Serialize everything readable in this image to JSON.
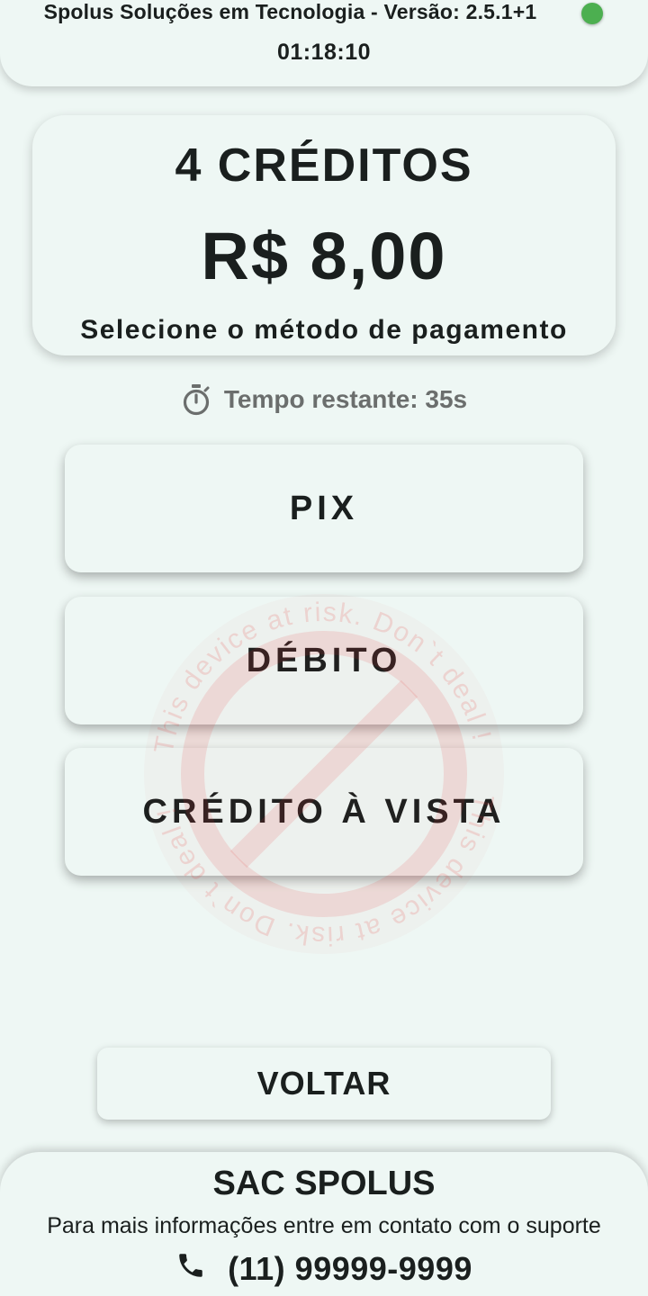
{
  "header": {
    "title": "Spolus Soluções em Tecnologia - Versão: 2.5.1+1",
    "clock": "01:18:10",
    "status_color": "#4caf50"
  },
  "summary": {
    "credits": "4 CRÉDITOS",
    "price": "R$ 8,00",
    "instruction": "Selecione o método de pagamento"
  },
  "timer": {
    "icon": "stopwatch-icon",
    "text": "Tempo restante: 35s"
  },
  "payment_methods": [
    {
      "label": "PIX"
    },
    {
      "label": "DÉBITO"
    },
    {
      "label": "CRÉDITO À VISTA"
    }
  ],
  "watermark": {
    "text": "This device at risk. Don`t deal !",
    "color": "#e53935"
  },
  "back_label": "VOLTAR",
  "footer": {
    "title": "SAC SPOLUS",
    "text": "Para mais informações entre em contato com o suporte",
    "phone_icon": "phone-icon",
    "phone": "(11) 99999-9999"
  }
}
